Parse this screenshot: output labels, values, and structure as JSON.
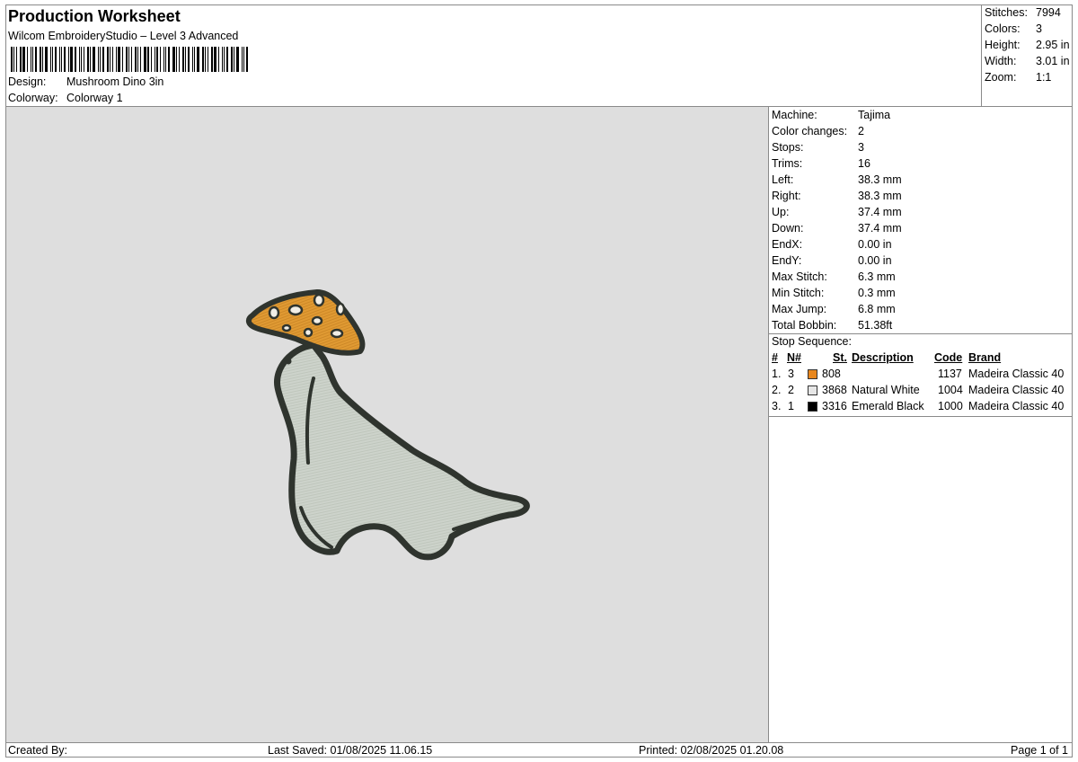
{
  "header": {
    "title": "Production Worksheet",
    "subtitle": "Wilcom EmbroideryStudio – Level 3 Advanced",
    "design_label": "Design:",
    "design_value": "Mushroom Dino 3in",
    "colorway_label": "Colorway:",
    "colorway_value": "Colorway 1"
  },
  "summary": [
    {
      "label": "Stitches:",
      "value": "7994"
    },
    {
      "label": "Colors:",
      "value": "3"
    },
    {
      "label": "Height:",
      "value": "2.95 in"
    },
    {
      "label": "Width:",
      "value": "3.01 in"
    },
    {
      "label": "Zoom:",
      "value": "1:1"
    }
  ],
  "details": [
    {
      "label": "Machine:",
      "value": "Tajima"
    },
    {
      "label": "Color changes:",
      "value": "2"
    },
    {
      "label": "Stops:",
      "value": "3"
    },
    {
      "label": "Trims:",
      "value": "16"
    },
    {
      "label": "Left:",
      "value": "38.3 mm"
    },
    {
      "label": "Right:",
      "value": "38.3 mm"
    },
    {
      "label": "Up:",
      "value": "37.4 mm"
    },
    {
      "label": "Down:",
      "value": "37.4 mm"
    },
    {
      "label": "EndX:",
      "value": "0.00 in"
    },
    {
      "label": "EndY:",
      "value": "0.00 in"
    },
    {
      "label": "Max Stitch:",
      "value": "6.3 mm"
    },
    {
      "label": "Min Stitch:",
      "value": "0.3 mm"
    },
    {
      "label": "Max Jump:",
      "value": "6.8 mm"
    },
    {
      "label": "Total Bobbin:",
      "value": "51.38ft"
    }
  ],
  "stop_sequence": {
    "title": "Stop Sequence:",
    "headers": {
      "num": "#",
      "needle": "N#",
      "stitches": "St.",
      "description": "Description",
      "code": "Code",
      "brand": "Brand"
    },
    "rows": [
      {
        "num": "1.",
        "needle": "3",
        "color": "#e8871e",
        "stitches": "808",
        "description": "",
        "code": "1137",
        "brand": "Madeira Classic 40"
      },
      {
        "num": "2.",
        "needle": "2",
        "color": "#e6e6e6",
        "stitches": "3868",
        "description": "Natural White",
        "code": "1004",
        "brand": "Madeira Classic 40"
      },
      {
        "num": "3.",
        "needle": "1",
        "color": "#000000",
        "stitches": "3316",
        "description": "Emerald Black",
        "code": "1000",
        "brand": "Madeira Classic 40"
      }
    ]
  },
  "footer": {
    "created_by": "Created By:",
    "last_saved": "Last Saved: 01/08/2025 11.06.15",
    "printed": "Printed: 02/08/2025 01.20.08",
    "page": "Page 1 of 1"
  },
  "colors": {
    "canvas_bg": "#dedede",
    "body_fill": "#cdd3cb",
    "outline": "#2f342e",
    "cap_fill": "#e09a33",
    "spots": "#f1eee6"
  }
}
